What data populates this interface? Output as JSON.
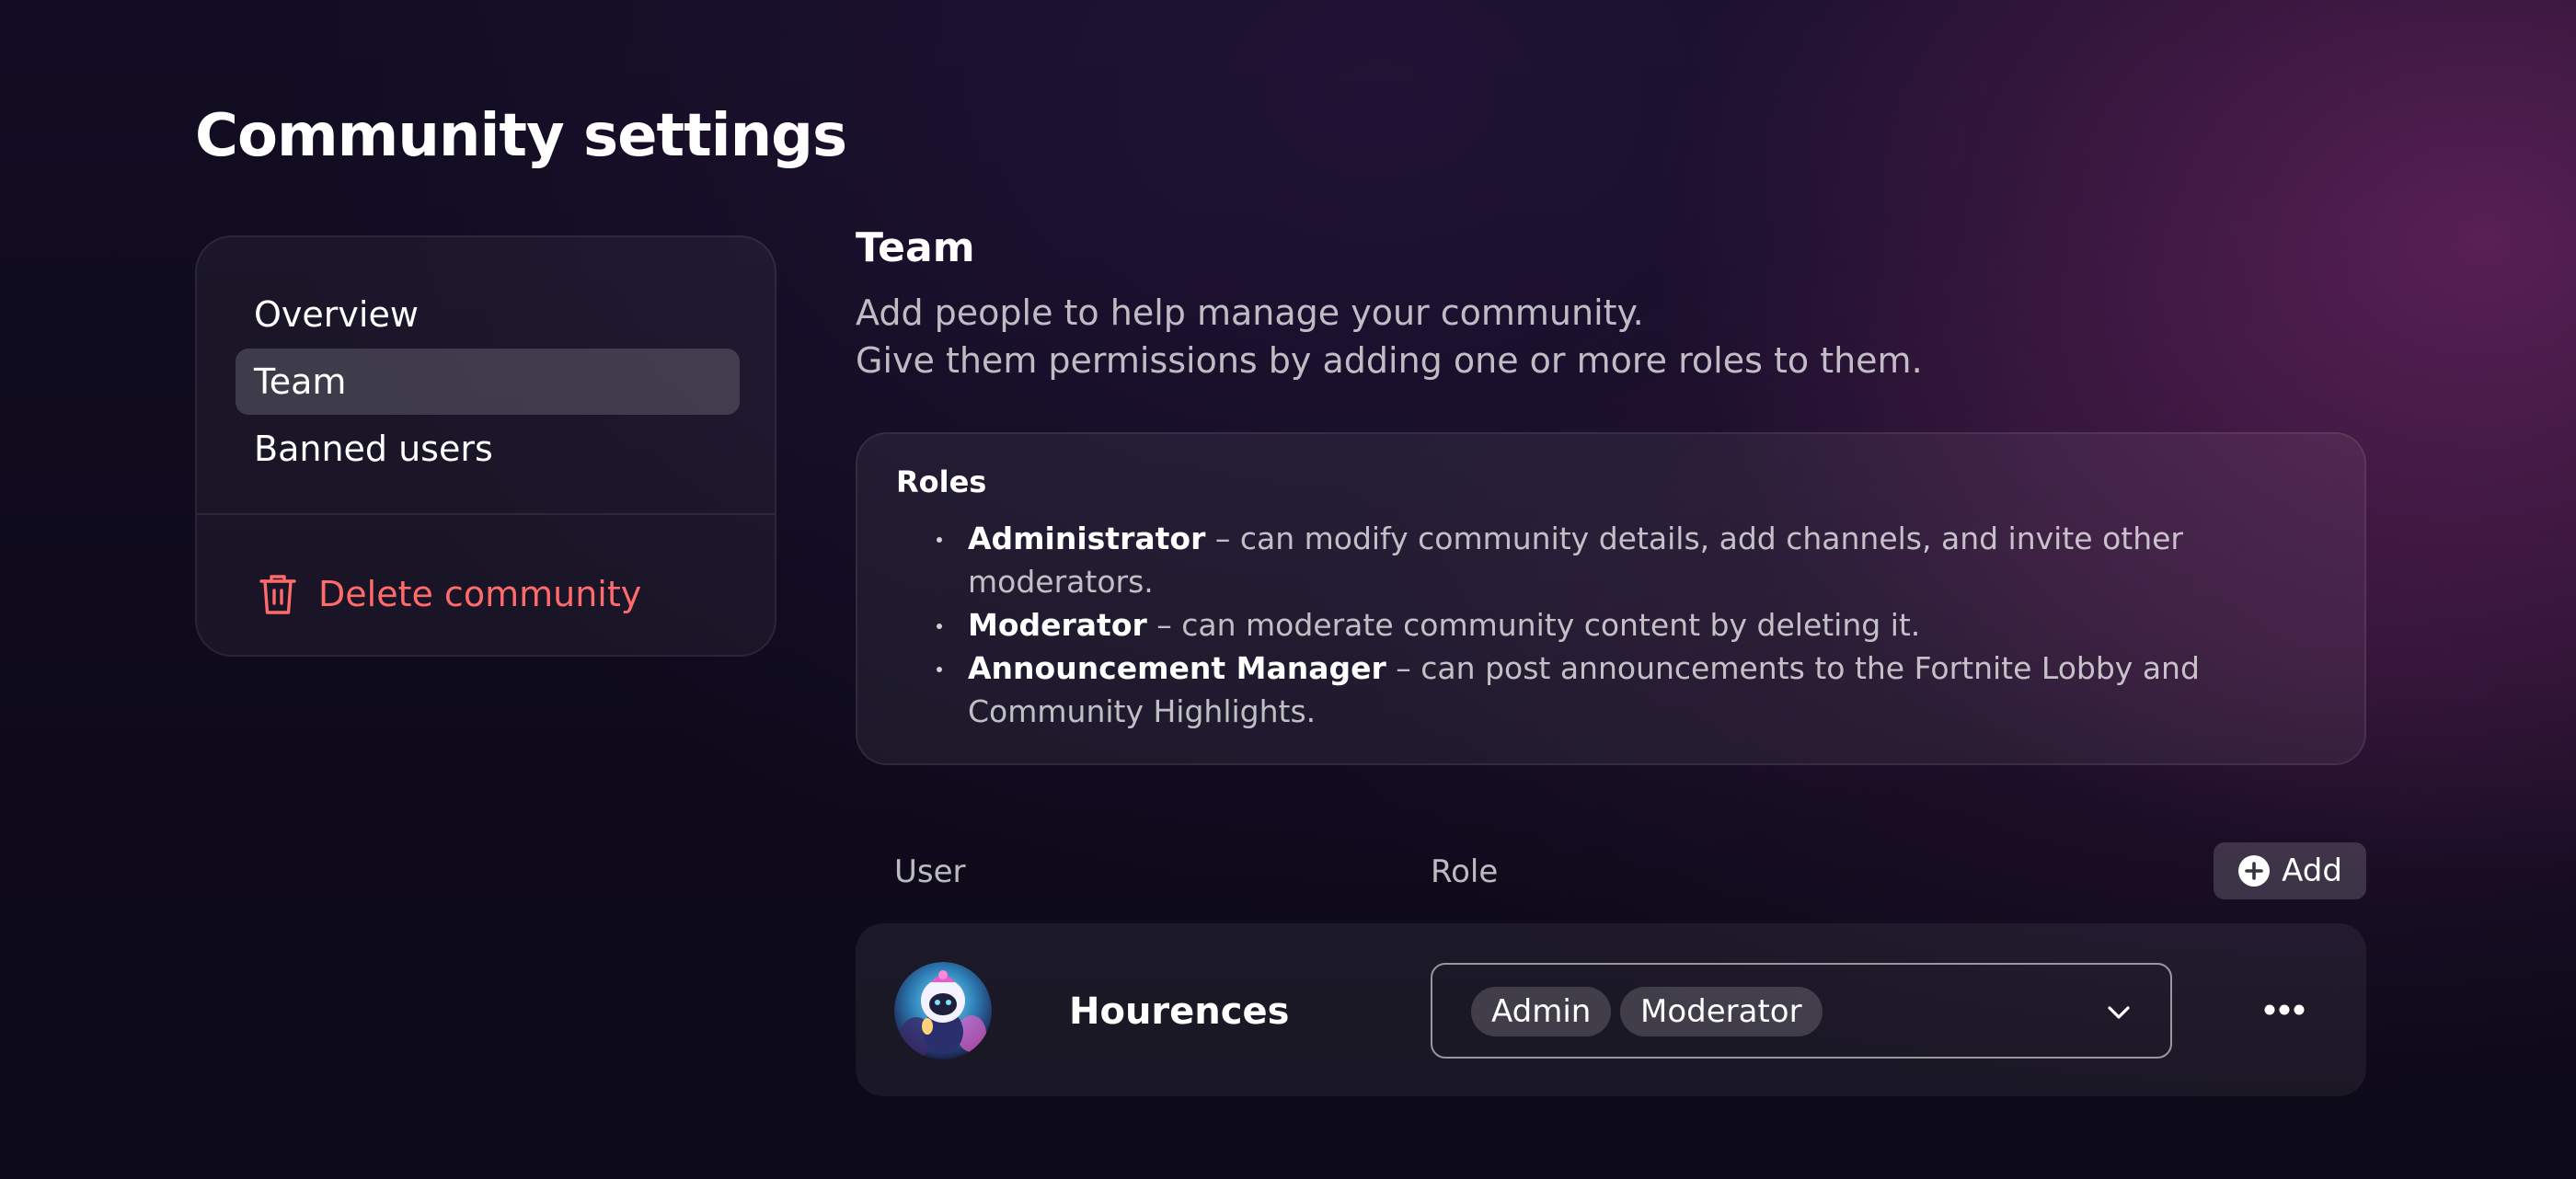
{
  "page": {
    "title": "Community settings"
  },
  "sidebar": {
    "items": [
      {
        "label": "Overview",
        "active": false
      },
      {
        "label": "Team",
        "active": true
      },
      {
        "label": "Banned users",
        "active": false
      }
    ],
    "delete_label": "Delete community",
    "delete_icon": "trash-icon",
    "delete_color": "#ff6a6a"
  },
  "team": {
    "title": "Team",
    "description_line1": "Add people to help manage your community.",
    "description_line2": "Give them permissions by adding one or more roles to them."
  },
  "roles": {
    "title": "Roles",
    "items": [
      {
        "name": "Administrator",
        "description": " – can modify community details, add channels, and invite other moderators."
      },
      {
        "name": "Moderator",
        "description": " – can moderate community content by deleting it."
      },
      {
        "name": "Announcement Manager",
        "description": " – can post announcements to the Fortnite Lobby and Community Highlights."
      }
    ]
  },
  "table": {
    "columns": {
      "user": "User",
      "role": "Role"
    },
    "add_label": "Add",
    "add_icon": "plus-circle-icon",
    "rows": [
      {
        "username": "Hourences",
        "avatar_icon": "avatar",
        "roles": [
          "Admin",
          "Moderator"
        ],
        "dropdown_icon": "chevron-down-icon",
        "more_icon": "more-horizontal-icon"
      }
    ]
  },
  "colors": {
    "background": "#0d0a1c",
    "accent_glow": "#702666",
    "danger": "#ff6a6a",
    "text_primary": "#ffffff",
    "text_secondary": "#b8b4c4"
  }
}
